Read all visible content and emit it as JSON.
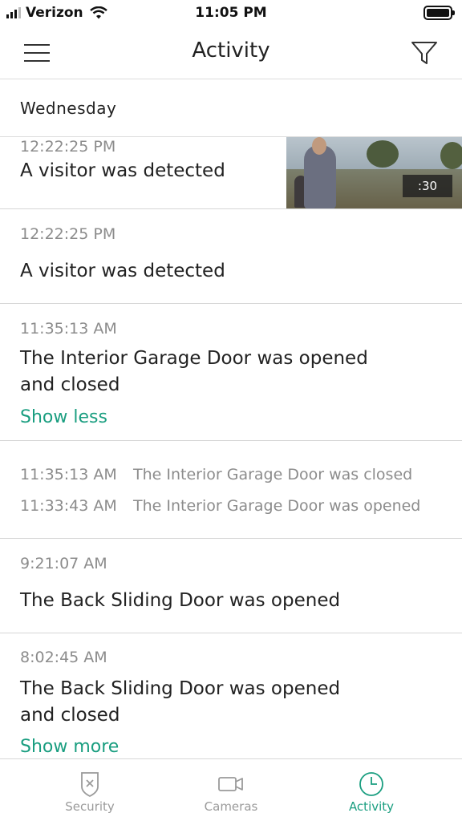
{
  "status_bar": {
    "carrier": "Verizon",
    "time": "11:05 PM"
  },
  "header": {
    "title": "Activity",
    "menu_icon": "hamburger-menu-icon",
    "filter_icon": "filter-funnel-icon"
  },
  "day_header": "Wednesday",
  "events": [
    {
      "time": "12:22:25 PM",
      "description": "A visitor was detected",
      "video_duration": ":30"
    },
    {
      "time": "12:22:25 PM",
      "description": "A visitor was detected"
    },
    {
      "time": "11:35:13 AM",
      "description_line1": "The Interior Garage Door was opened",
      "description_line2": "and closed",
      "toggle": "Show less"
    },
    {
      "time": "9:21:07 AM",
      "description": "The Back Sliding Door was opened"
    },
    {
      "time": "8:02:45 AM",
      "description_line1": "The Back Sliding Door was opened",
      "description_line2": "and closed",
      "toggle": "Show more"
    }
  ],
  "sub_events": [
    {
      "time": "11:35:13 AM",
      "description": "The Interior Garage Door was closed"
    },
    {
      "time": "11:33:43 AM",
      "description": "The Interior Garage Door was opened"
    }
  ],
  "tabs": [
    {
      "label": "Security",
      "icon": "shield-icon",
      "active": false
    },
    {
      "label": "Cameras",
      "icon": "video-camera-icon",
      "active": false
    },
    {
      "label": "Activity",
      "icon": "clock-icon",
      "active": true
    }
  ],
  "colors": {
    "accent": "#1a9e80",
    "muted_text": "#8c8c8c",
    "divider": "#d6d6d6"
  }
}
